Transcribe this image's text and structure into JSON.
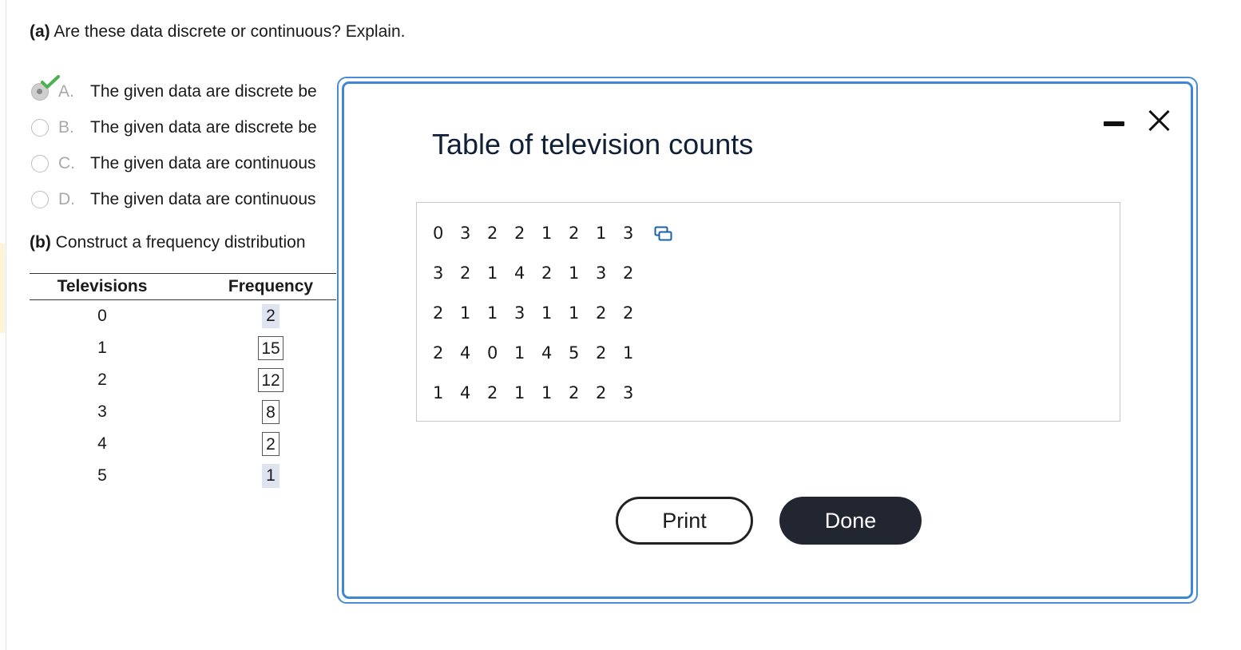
{
  "question_a": {
    "part": "(a)",
    "text": "Are these data discrete or continuous? Explain."
  },
  "options": [
    {
      "letter": "A.",
      "text": "The given data are discrete be",
      "selected": true,
      "correct": true
    },
    {
      "letter": "B.",
      "text": "The given data are discrete be",
      "selected": false
    },
    {
      "letter": "C.",
      "text": "The given data are continuous",
      "selected": false
    },
    {
      "letter": "D.",
      "text": "The given data are continuous",
      "selected": false
    }
  ],
  "question_b": {
    "part": "(b)",
    "text": "Construct a frequency distribution"
  },
  "freq_table": {
    "headers": [
      "Televisions",
      "Frequency"
    ],
    "rows": [
      {
        "televisions": "0",
        "frequency": "2",
        "style": "shaded"
      },
      {
        "televisions": "1",
        "frequency": "15",
        "style": "boxed"
      },
      {
        "televisions": "2",
        "frequency": "12",
        "style": "boxed"
      },
      {
        "televisions": "3",
        "frequency": "8",
        "style": "boxed"
      },
      {
        "televisions": "4",
        "frequency": "2",
        "style": "boxed"
      },
      {
        "televisions": "5",
        "frequency": "1",
        "style": "shaded"
      }
    ]
  },
  "modal": {
    "title": "Table of television counts",
    "data_rows": [
      [
        "0",
        "3",
        "2",
        "2",
        "1",
        "2",
        "1",
        "3"
      ],
      [
        "3",
        "2",
        "1",
        "4",
        "2",
        "1",
        "3",
        "2"
      ],
      [
        "2",
        "1",
        "1",
        "3",
        "1",
        "1",
        "2",
        "2"
      ],
      [
        "2",
        "4",
        "0",
        "1",
        "4",
        "5",
        "2",
        "1"
      ],
      [
        "1",
        "4",
        "2",
        "1",
        "1",
        "2",
        "2",
        "3"
      ]
    ],
    "print_label": "Print",
    "done_label": "Done"
  },
  "colors": {
    "accent_border": "#3f87d4",
    "done_button": "#212631",
    "check": "#4caf50",
    "shaded_answer": "#dde4ef"
  }
}
